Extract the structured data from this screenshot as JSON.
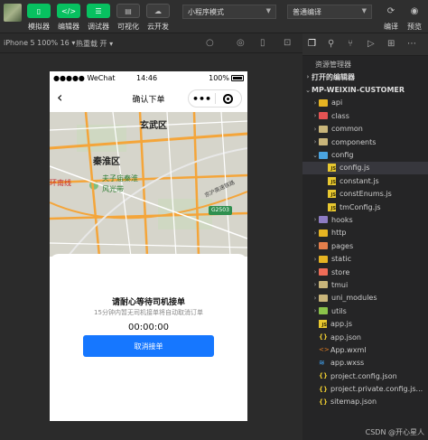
{
  "toolbar": {
    "buttons": [
      {
        "label": "模拟器"
      },
      {
        "label": "编辑器"
      },
      {
        "label": "调试器"
      },
      {
        "label": "可视化"
      },
      {
        "label": "云开发"
      }
    ],
    "mode_select": "小程序模式",
    "compile_select": "普通编译",
    "right": [
      {
        "label": "编译"
      },
      {
        "label": "预览"
      }
    ]
  },
  "sim_toolbar": {
    "device": "iPhone 5 100% 16 ▾",
    "hot_reload": "热重载 开 ▾"
  },
  "phone": {
    "carrier": "●●●●● WeChat",
    "time": "14:46",
    "battery": "100%",
    "nav_title": "确认下单",
    "back_glyph": "‹",
    "map_labels": {
      "xuanwu": "玄武区",
      "qinhuai": "秦淮区",
      "fuzimiao": "夫子庙秦淮",
      "fengguang": "风光带",
      "road_left": "环南线",
      "road_right": "京沪高速铁路",
      "badge": "G2503"
    },
    "sheet_title": "请耐心等待司机接单",
    "sheet_subtitle": "15分钟内暂无司机接单将自动取消订单",
    "timer": "00:00:00",
    "cancel_label": "取消接单"
  },
  "explorer": {
    "title": "资源管理器",
    "open_editors": "打开的编辑器",
    "project": "MP-WEIXIN-CUSTOMER",
    "rows": [
      {
        "label": "api",
        "type": "folder",
        "color": "#e6b422"
      },
      {
        "label": "class",
        "type": "folder",
        "color": "#e55353"
      },
      {
        "label": "common",
        "type": "folder",
        "color": "#c9b57a"
      },
      {
        "label": "components",
        "type": "folder",
        "color": "#c9b57a"
      },
      {
        "label": "config",
        "type": "folder-open",
        "color": "#4aa3df"
      },
      {
        "label": "config.js",
        "type": "js"
      },
      {
        "label": "constant.js",
        "type": "js"
      },
      {
        "label": "constEnums.js",
        "type": "js"
      },
      {
        "label": "tmConfig.js",
        "type": "js"
      },
      {
        "label": "hooks",
        "type": "folder",
        "color": "#8e7cc3"
      },
      {
        "label": "http",
        "type": "folder",
        "color": "#e6b422"
      },
      {
        "label": "pages",
        "type": "folder",
        "color": "#e57f4b"
      },
      {
        "label": "static",
        "type": "folder",
        "color": "#e6b422"
      },
      {
        "label": "store",
        "type": "folder",
        "color": "#ef6c57"
      },
      {
        "label": "tmui",
        "type": "folder",
        "color": "#c9b57a"
      },
      {
        "label": "uni_modules",
        "type": "folder",
        "color": "#c9b57a"
      },
      {
        "label": "utils",
        "type": "folder",
        "color": "#8bc34a"
      },
      {
        "label": "app.js",
        "type": "js"
      },
      {
        "label": "app.json",
        "type": "json"
      },
      {
        "label": "App.wxml",
        "type": "xml"
      },
      {
        "label": "app.wxss",
        "type": "wxss"
      },
      {
        "label": "project.config.json",
        "type": "json"
      },
      {
        "label": "project.private.config.js...",
        "type": "json"
      },
      {
        "label": "sitemap.json",
        "type": "json"
      }
    ]
  },
  "watermark": "CSDN @开心星人"
}
